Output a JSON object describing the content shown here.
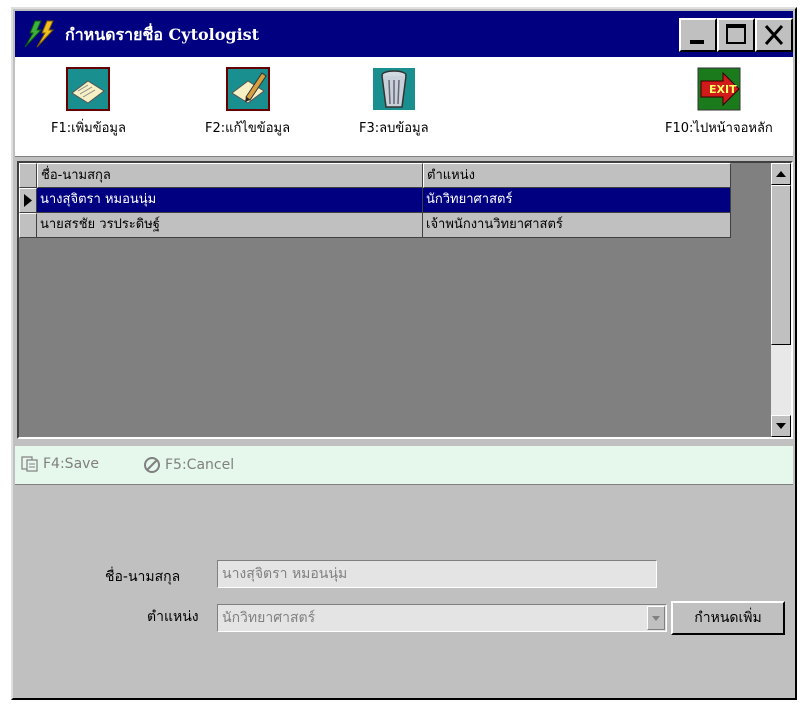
{
  "window": {
    "title": "กำหนดรายชื่อ Cytologist",
    "icons": {
      "app": "lightning-app-icon",
      "minimize": "minimize-icon",
      "maximize": "maximize-icon",
      "close": "close-icon"
    }
  },
  "toolbar": {
    "items": [
      {
        "label": "F1:เพิ่มข้อมูล",
        "icon": "add-record-icon"
      },
      {
        "label": "F2:แก้ไขข้อมูล",
        "icon": "edit-record-icon"
      },
      {
        "label": "F3:ลบข้อมูล",
        "icon": "trash-icon"
      },
      {
        "label": "F10:ไปหน้าจอหลัก",
        "icon": "exit-icon"
      }
    ]
  },
  "grid": {
    "columns": [
      "ชื่อ-นามสกุล",
      "ตำแหน่ง"
    ],
    "rows": [
      {
        "name": "นางสุจิตรา หมอนนุ่ม",
        "position": "นักวิทยาศาสตร์",
        "selected": true
      },
      {
        "name": "นายสรชัย วรประดิษฐ์",
        "position": "เจ้าพนักงานวิทยาศาสตร์",
        "selected": false
      }
    ]
  },
  "actions": {
    "save_label": "F4:Save",
    "cancel_label": "F5:Cancel"
  },
  "form": {
    "name_label": "ชื่อ-นามสกุล",
    "name_value": "นางสุจิตรา หมอนนุ่ม",
    "position_label": "ตำแหน่ง",
    "position_value": "นักวิทยาศาสตร์",
    "add_position_button": "กำหนดเพิ่ม"
  },
  "colors": {
    "titlebar": "#000080",
    "selection": "#000080",
    "actionbar": "#e6f7ec",
    "face": "#c0c0c0"
  }
}
